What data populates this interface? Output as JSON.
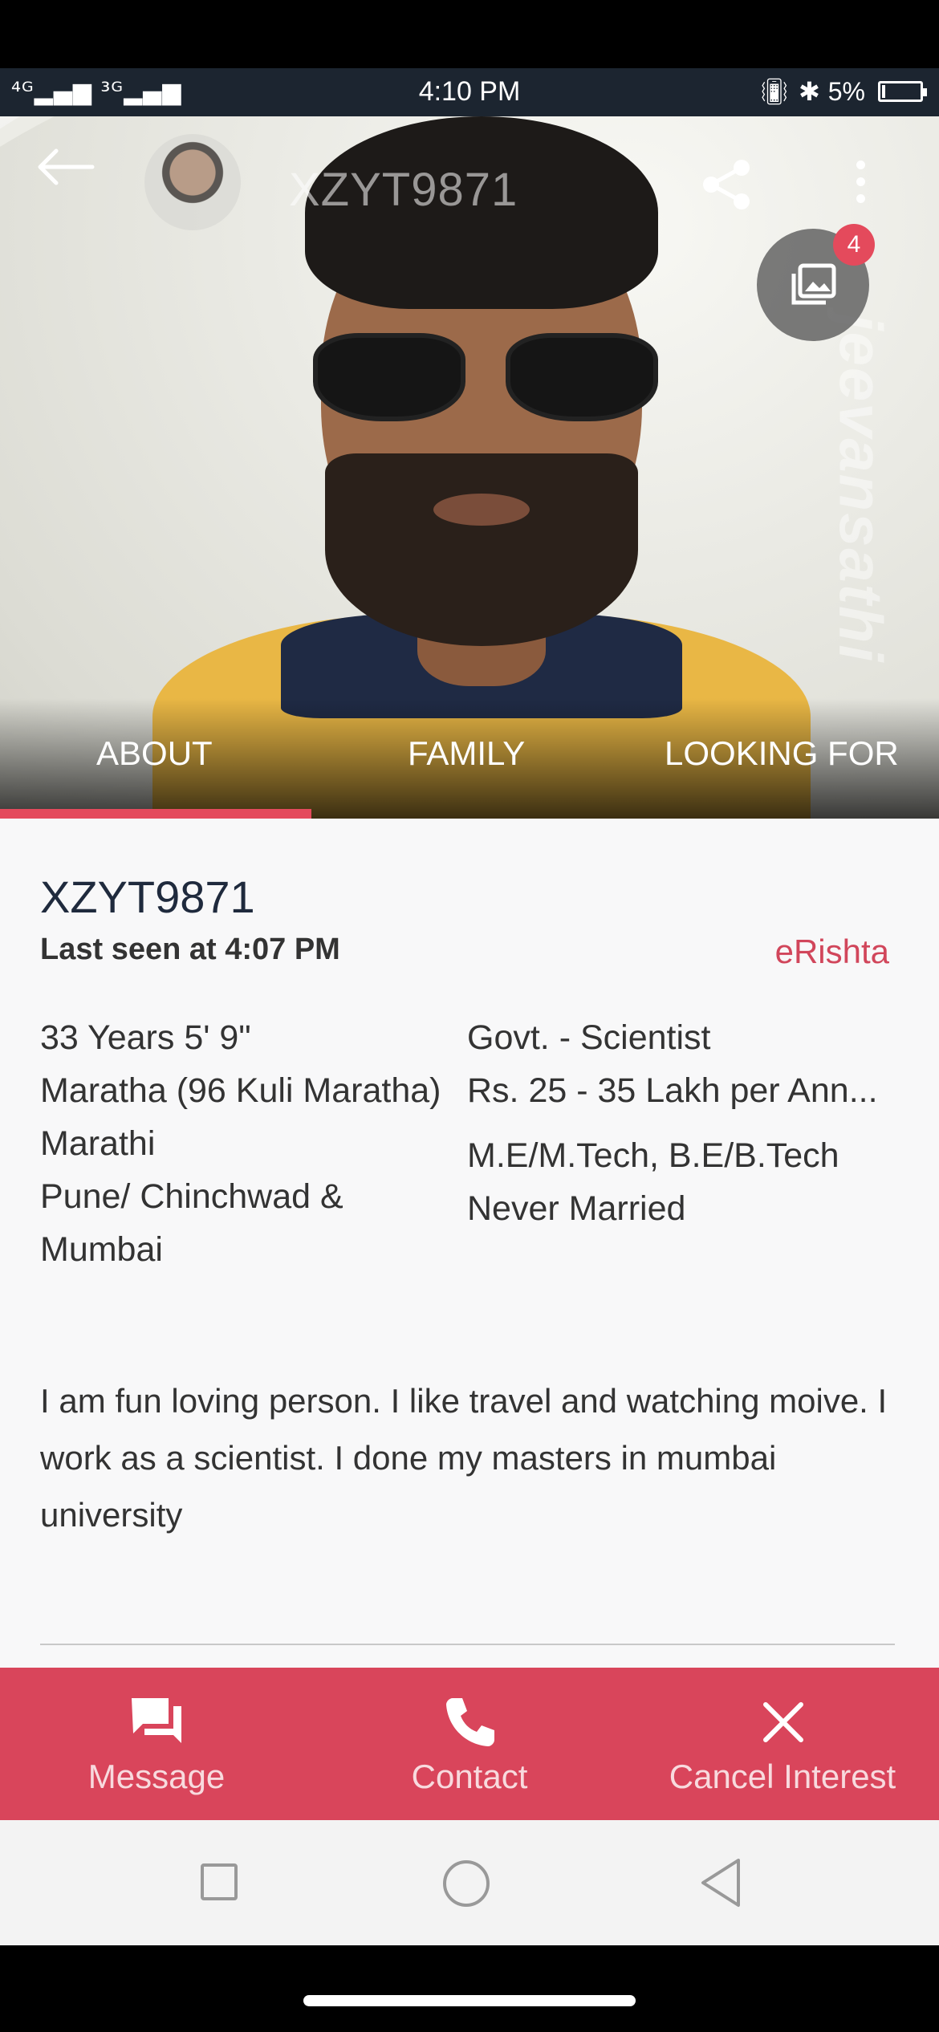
{
  "status_bar": {
    "signal": "4G 3G",
    "time": "4:10 PM",
    "battery": "5%"
  },
  "header": {
    "title": "XZYT9871",
    "gallery_count": "4",
    "watermark": "jeevansathi"
  },
  "tabs": [
    "ABOUT",
    "FAMILY",
    "LOOKING FOR"
  ],
  "profile": {
    "id": "XZYT9871",
    "last_seen": "Last seen at 4:07 PM",
    "membership": "eRishta",
    "left_details": [
      "33 Years 5' 9\"",
      "Maratha (96 Kuli Maratha)",
      "Marathi",
      "Pune/ Chinchwad &",
      "Mumbai"
    ],
    "right_details": [
      "Govt. - Scientist",
      "Rs. 25 - 35 Lakh per Ann...",
      "M.E/M.Tech, B.E/B.Tech",
      "Never Married"
    ],
    "about": "I am fun loving person. I like travel and watching moive. I work as a scientist. I done my masters in mumbai university"
  },
  "actions": {
    "message": "Message",
    "contact": "Contact",
    "cancel": "Cancel Interest"
  },
  "colors": {
    "accent": "#d9455b",
    "badge": "#e44a5c",
    "membership": "#d1465b"
  }
}
